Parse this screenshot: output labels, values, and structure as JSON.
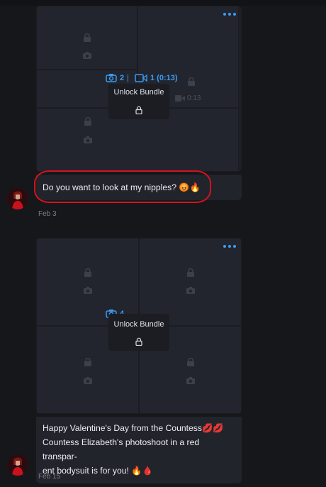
{
  "messages": [
    {
      "media_counts": {
        "photos": "2",
        "separator": "|",
        "videos": "1 (0:13)"
      },
      "video_duration": "0:13",
      "unlock_label": "Unlock Bundle",
      "caption": "Do you want to look at my nipples? 😡🔥",
      "date": "Feb 3"
    },
    {
      "media_counts": {
        "photos": "4"
      },
      "unlock_label": "Unlock Bundle",
      "caption_lines": [
        "Happy Valentine's Day from the Countess💋💋",
        "Countess Elizabeth's photoshoot in a red transpar-",
        "ent bodysuit is for you! 🔥🩸"
      ],
      "date": "Feb 15"
    }
  ],
  "colors": {
    "accent": "#3b9bf5",
    "highlight": "#d6121e",
    "background": "#16171b"
  },
  "icons": [
    "more-dots-icon",
    "lock-icon",
    "camera-icon",
    "video-icon"
  ]
}
